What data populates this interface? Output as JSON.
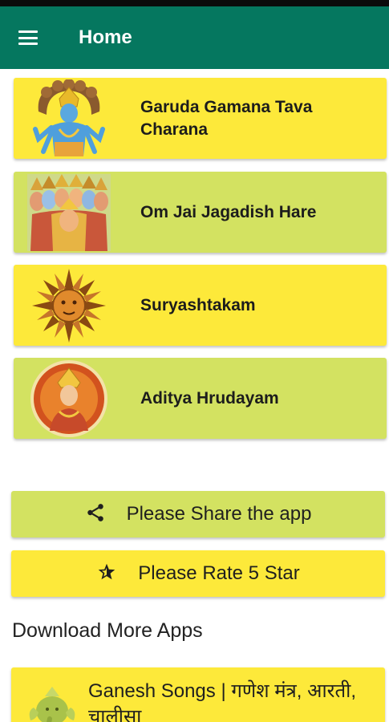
{
  "app_bar": {
    "title": "Home",
    "menu_icon": "hamburger-menu-icon",
    "color": "#05775f"
  },
  "songs": [
    {
      "title": "Garuda Gamana Tava Charana",
      "image": "vishnu-with-sheshnag-image",
      "color": "#fde93a"
    },
    {
      "title": "Om Jai Jagadish Hare",
      "image": "vishwaroop-many-heads-image",
      "color": "#d3e261"
    },
    {
      "title": "Suryashtakam",
      "image": "sun-face-image",
      "color": "#fde93a"
    },
    {
      "title": "Aditya Hrudayam",
      "image": "surya-deity-medallion-image",
      "color": "#d3e261"
    }
  ],
  "actions": {
    "share": {
      "label": "Please Share the app",
      "icon": "share-icon"
    },
    "rate": {
      "label": "Please Rate 5 Star",
      "icon": "star-icon"
    }
  },
  "more_apps": {
    "heading": "Download More Apps",
    "items": [
      {
        "name": "Ganesh Songs | गणेश मंत्र, आरती, चालीसा",
        "image": "ganesh-idol-image"
      }
    ]
  }
}
